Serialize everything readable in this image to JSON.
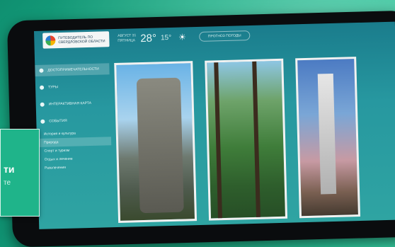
{
  "header": {
    "logo_line1": "ПУТЕВОДИТЕЛЬ ПО",
    "logo_line2": "СВЕРДЛОВСКОЙ ОБЛАСТИ",
    "date_line1": "АВГУСТ 31",
    "date_line2": "ПЯТНИЦА",
    "temp_day": "28°",
    "temp_night": "15°",
    "weather_icon": "sun-icon",
    "forecast_label": "ПРОГНОЗ ПОГОДЫ"
  },
  "sidebar": {
    "items": [
      {
        "label": "ДОСТОПРИМЕЧАТЕЛЬНОСТИ",
        "active": true
      },
      {
        "label": "ТУРЫ"
      },
      {
        "label": "ИНТЕРАКТИВНАЯ КАРТА"
      },
      {
        "label": "СОБЫТИЯ"
      }
    ],
    "subitems": [
      {
        "label": "История и культура"
      },
      {
        "label": "Природа",
        "active": true
      },
      {
        "label": "Спорт и туризм"
      },
      {
        "label": "Отдых и лечение"
      },
      {
        "label": "Развлечения"
      }
    ]
  },
  "overlay": {
    "title": "ти",
    "subtitle": "те"
  }
}
